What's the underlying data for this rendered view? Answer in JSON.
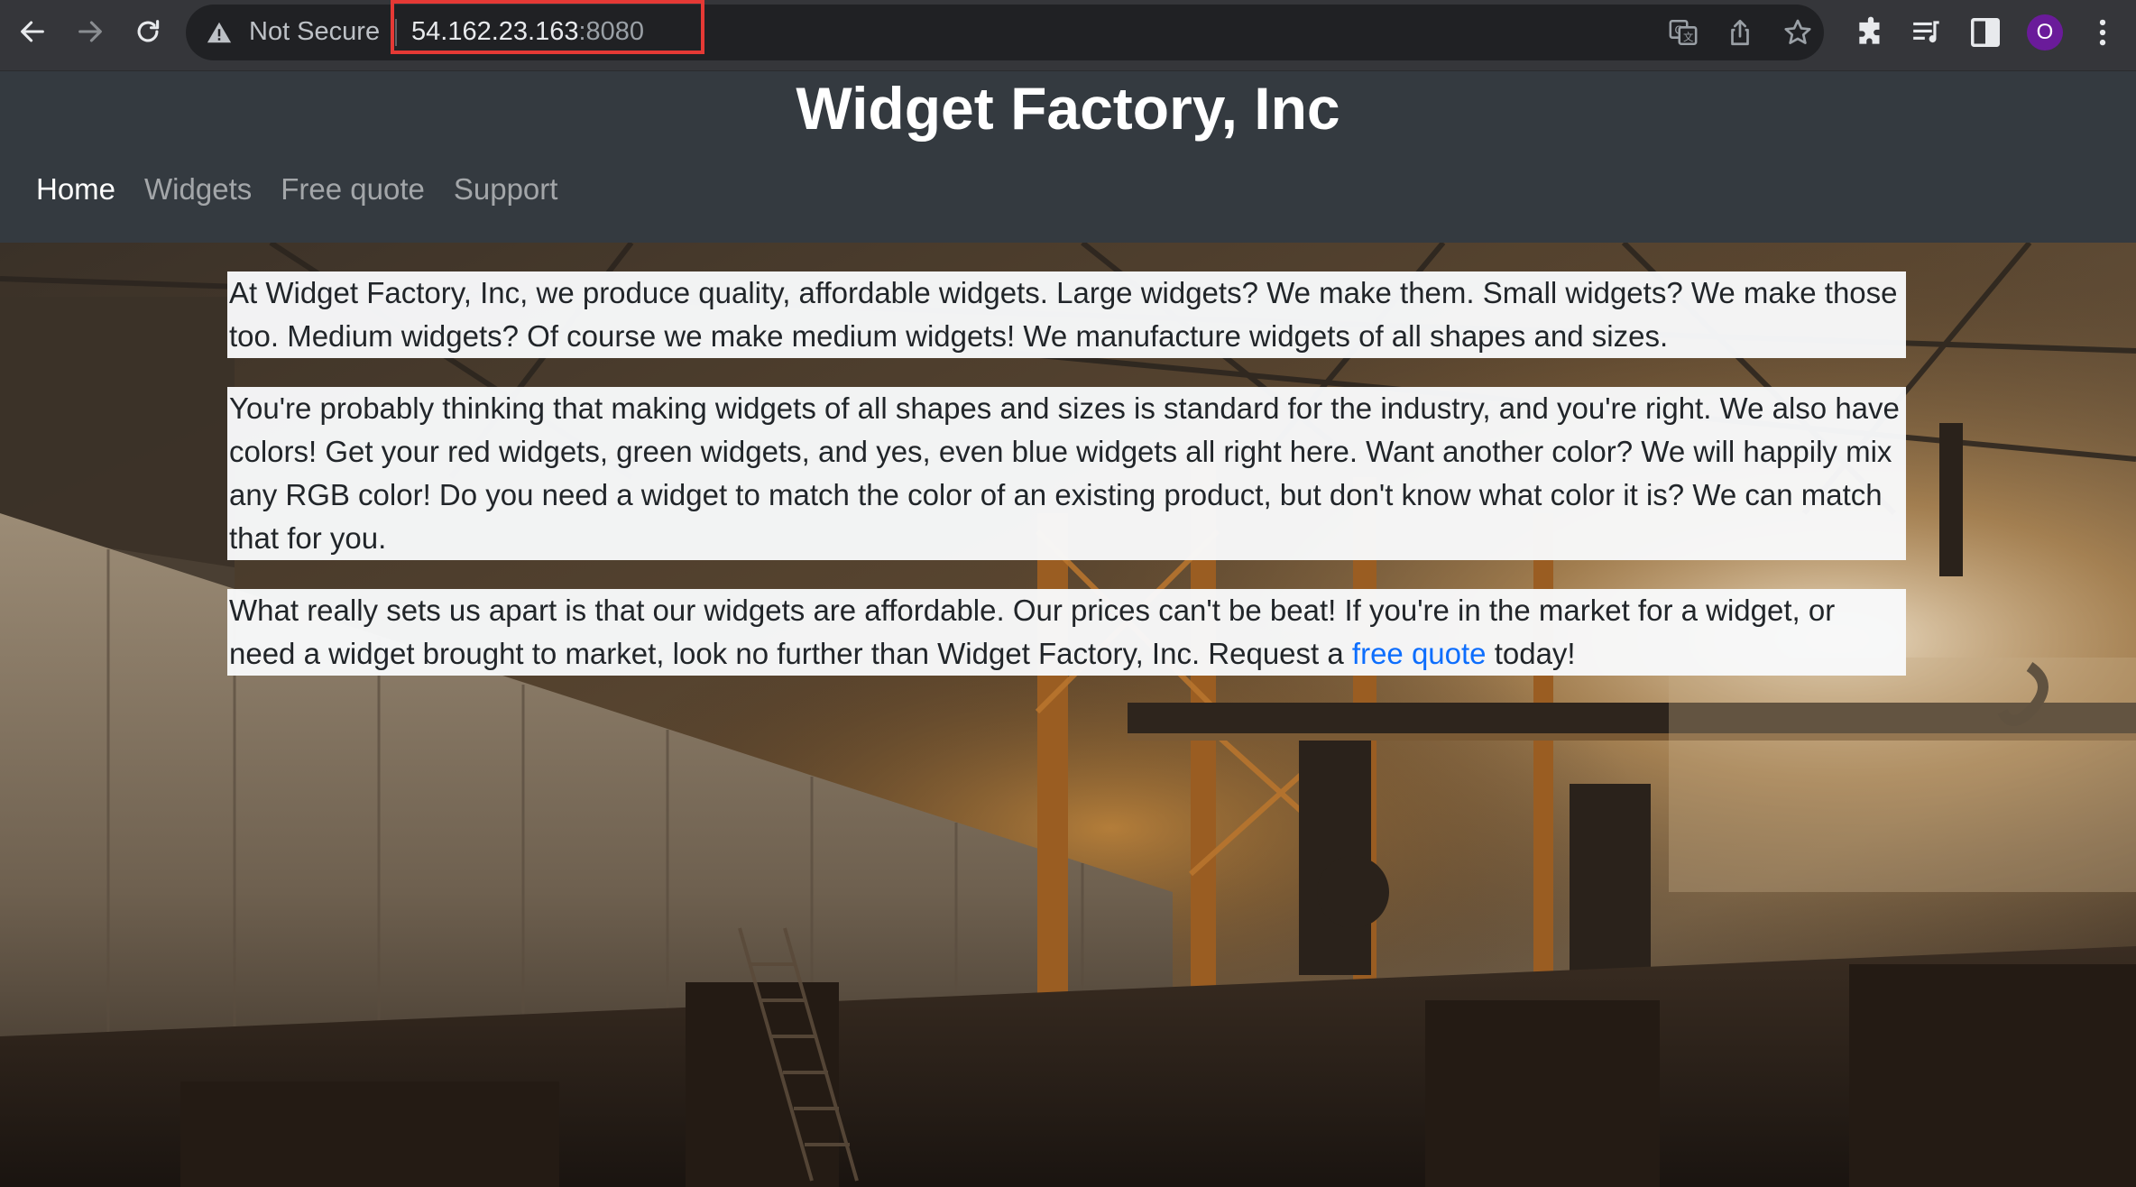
{
  "browser": {
    "security_label": "Not Secure",
    "url_host": "54.162.23.163",
    "url_port": ":8080",
    "profile_initial": "O",
    "icons": {
      "back": "arrow-left-icon",
      "forward": "arrow-right-icon",
      "reload": "reload-icon",
      "warning": "warning-triangle-icon",
      "translate": "translate-icon",
      "share": "share-icon",
      "bookmark": "star-icon",
      "extensions": "puzzle-icon",
      "reading_list": "reading-list-icon",
      "side_panel": "side-panel-icon",
      "menu": "kebab-menu-icon"
    },
    "colors": {
      "toolbar": "#35363a",
      "omnibox": "#202124",
      "highlight_box": "#e53935",
      "avatar": "#6a1b9a"
    }
  },
  "site": {
    "title": "Widget Factory, Inc",
    "nav": [
      {
        "label": "Home",
        "active": true
      },
      {
        "label": "Widgets",
        "active": false
      },
      {
        "label": "Free quote",
        "active": false
      },
      {
        "label": "Support",
        "active": false
      }
    ],
    "colors": {
      "header_bg": "#343a40",
      "link": "#0d6efd"
    }
  },
  "content": {
    "p1": "At Widget Factory, Inc, we produce quality, affordable widgets. Large widgets? We make them. Small widgets? We make those too. Medium widgets? Of course we make medium widgets! We manufacture widgets of all shapes and sizes.",
    "p2": "You're probably thinking that making widgets of all shapes and sizes is standard for the industry, and you're right. We also have colors! Get your red widgets, green widgets, and yes, even blue widgets all right here. Want another color? We will happily mix any RGB color! Do you need a widget to match the color of an existing product, but don't know what color it is? We can match that for you.",
    "p3_before": "What really sets us apart is that our widgets are affordable. Our prices can't be beat! If you're in the market for a widget, or need a widget brought to market, look no further than Widget Factory, Inc. Request a ",
    "p3_link": "free quote",
    "p3_after": " today!"
  }
}
